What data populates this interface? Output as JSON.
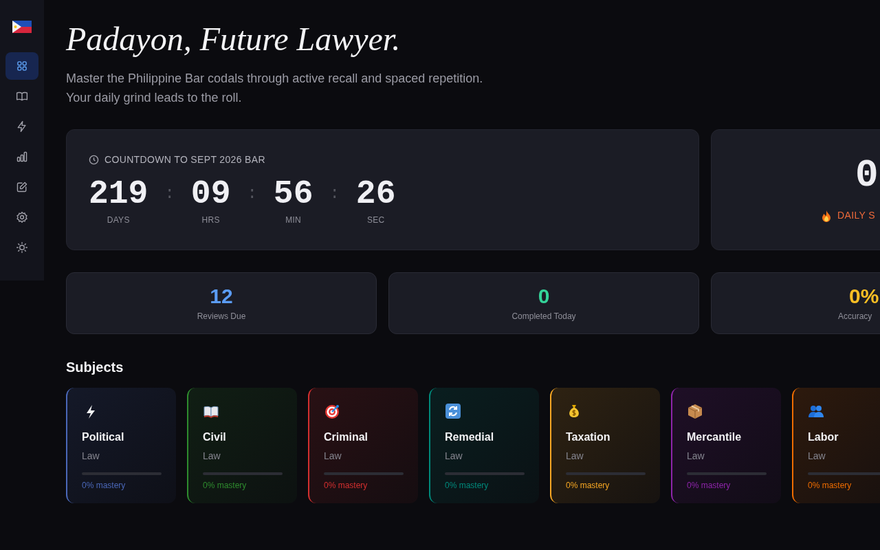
{
  "sidebar": {
    "items": [
      {
        "selected": true
      },
      {
        "selected": false
      },
      {
        "selected": false
      },
      {
        "selected": false
      },
      {
        "selected": false
      },
      {
        "selected": false
      },
      {
        "selected": false
      }
    ]
  },
  "hero": {
    "title": "Padayon, Future Lawyer.",
    "subtitle_lines": [
      "Master the Philippine Bar codals through active recall and spaced repetition.",
      "Your daily grind leads to the roll."
    ]
  },
  "countdown": {
    "heading": "COUNTDOWN TO SEPT 2026 BAR",
    "units": [
      {
        "value": "219",
        "label": "DAYS"
      },
      {
        "value": "09",
        "label": "HRS"
      },
      {
        "value": "56",
        "label": "MIN"
      },
      {
        "value": "26",
        "label": "SEC"
      }
    ],
    "separator": ":"
  },
  "streak": {
    "value": "0",
    "label": "DAILY S"
  },
  "stats": [
    {
      "value": "12",
      "label": "Reviews Due",
      "color": "#5b9cf4"
    },
    {
      "value": "0",
      "label": "Completed Today",
      "color": "#34d399"
    },
    {
      "value": "0%",
      "label": "Accuracy",
      "color": "#fbbf24"
    }
  ],
  "subjects_heading": "Subjects",
  "subjects": [
    {
      "name": "Political",
      "sub": "Law",
      "mastery": "0% mastery",
      "level": 0,
      "color": "#4a67b8"
    },
    {
      "name": "Civil",
      "sub": "Law",
      "mastery": "0% mastery",
      "level": 0,
      "color": "#2e8b2e"
    },
    {
      "name": "Criminal",
      "sub": "Law",
      "mastery": "0% mastery",
      "level": 0,
      "color": "#d32f2f"
    },
    {
      "name": "Remedial",
      "sub": "Law",
      "mastery": "0% mastery",
      "level": 0,
      "color": "#00897b"
    },
    {
      "name": "Taxation",
      "sub": "Law",
      "mastery": "0% mastery",
      "level": 0,
      "color": "#f5a623"
    },
    {
      "name": "Mercantile",
      "sub": "Law",
      "mastery": "0% mastery",
      "level": 0,
      "color": "#8e24aa"
    },
    {
      "name": "Labor",
      "sub": "Law",
      "mastery": "0% mastery",
      "level": 0,
      "color": "#ef6c00"
    }
  ]
}
